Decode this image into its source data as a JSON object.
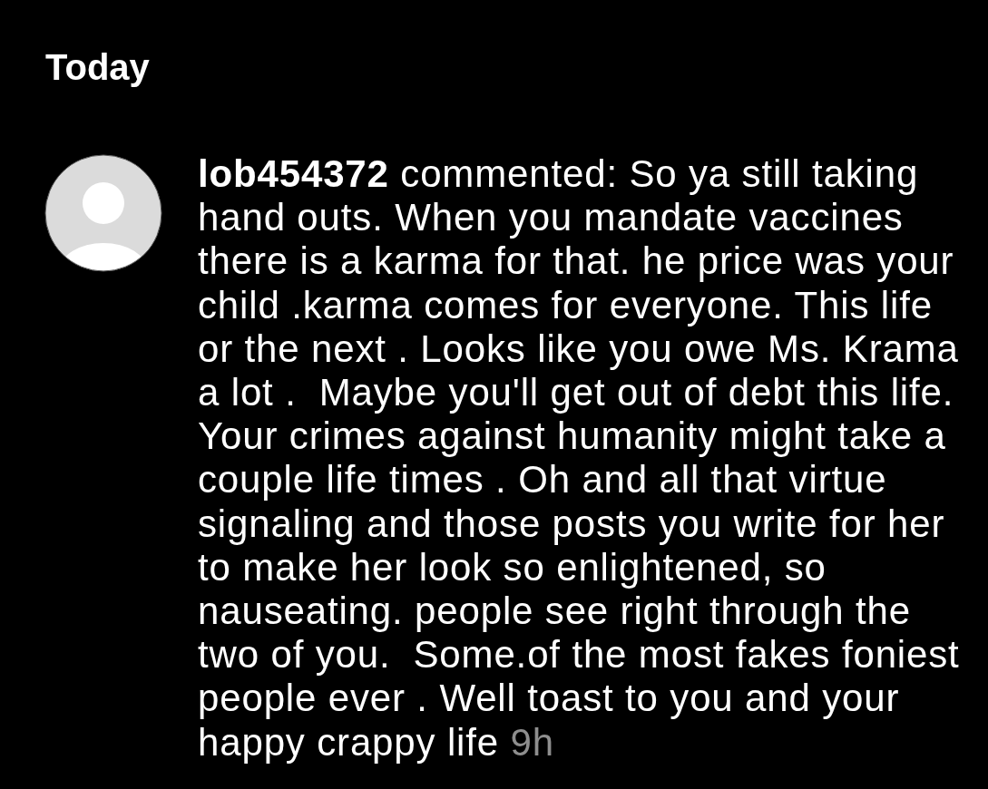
{
  "section_title": "Today",
  "notification": {
    "text": "**lob454372** commented: So ya still taking hand outs. When you mandate vaccines there is a karma for that. he price was your child .karma comes for everyone. This life or the next . Looks like you owe Ms. Krama a lot .  Maybe you'll get out of debt this life. Your crimes against humanity might take a couple life times . Oh and all that virtue signaling and those posts you write for her to make her look so enlightened, so nauseating. people see right through the two of you.  Some.of the most fakes foniest people ever . Well toast to you and your happy crappy life",
    "time": "9h"
  }
}
